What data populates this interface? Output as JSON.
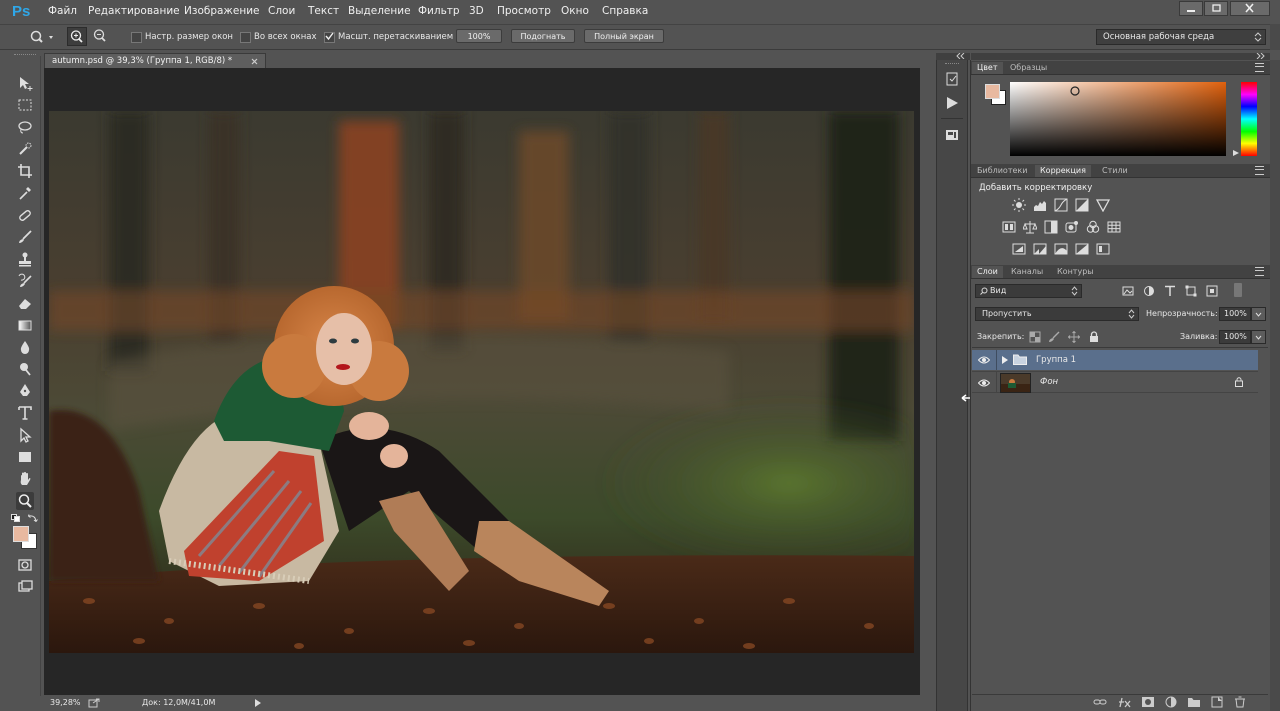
{
  "app": {
    "logo": "Ps"
  },
  "menu": [
    "Файл",
    "Редактирование",
    "Изображение",
    "Слои",
    "Текст",
    "Выделение",
    "Фильтр",
    "3D",
    "Просмотр",
    "Окно",
    "Справка"
  ],
  "options": {
    "resize_windows": "Настр. размер окон",
    "all_windows": "Во всех окнах",
    "scrubby_zoom": "Масшт. перетаскиванием",
    "zoom_value": "100%",
    "fit": "Подогнать",
    "fullscreen": "Полный экран",
    "workspace": "Основная рабочая среда",
    "scrubby_checked": true
  },
  "document": {
    "tab_title": "autumn.psd @ 39,3% (Группа 1, RGB/8) *",
    "zoom": "39,28%",
    "doc_size": "Док: 12,0M/41,0M"
  },
  "color_panel": {
    "tabs": [
      "Цвет",
      "Образцы"
    ],
    "foreground": "#e8b9a0",
    "background": "#ffffff"
  },
  "adjustments_panel": {
    "tabs": [
      "Библиотеки",
      "Коррекция",
      "Стили"
    ],
    "title": "Добавить корректировку"
  },
  "layers_panel": {
    "tabs": [
      "Слои",
      "Каналы",
      "Контуры"
    ],
    "filter": "Вид",
    "blend_mode": "Пропустить",
    "opacity_label": "Непрозрачность:",
    "opacity": "100%",
    "lock_label": "Закрепить:",
    "fill_label": "Заливка:",
    "fill": "100%",
    "layers": [
      {
        "name": "Группа 1",
        "type": "group",
        "selected": true
      },
      {
        "name": "Фон",
        "type": "image",
        "locked": true
      }
    ]
  },
  "colors": {
    "accent": "#2fa7e8",
    "selected_layer": "#5a6f8c"
  }
}
